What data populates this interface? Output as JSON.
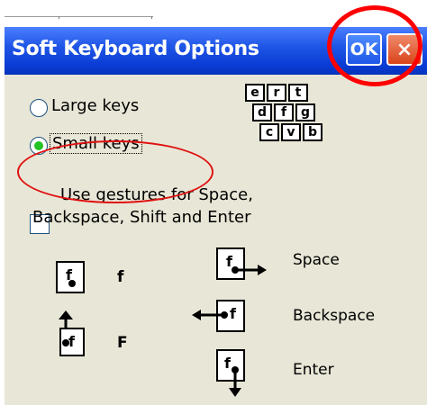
{
  "window": {
    "title": "Soft Keyboard Options",
    "ok_label": "OK",
    "close_label": "×"
  },
  "options": {
    "large_keys_label": "Large keys",
    "small_keys_label": "Small keys",
    "selected": "Small keys",
    "gestures_label_line1": "Use gestures for Space,",
    "gestures_label_line2": "Backspace, Shift and Enter",
    "gestures_checked": false
  },
  "preview_keys": {
    "row1": [
      "e",
      "r",
      "t"
    ],
    "row2": [
      "d",
      "f",
      "g"
    ],
    "row3": [
      "c",
      "v",
      "b"
    ]
  },
  "gesture_legend": {
    "icon_letter": "f",
    "tap_result": "f",
    "shift_result": "F",
    "space_label": "Space",
    "backspace_label": "Backspace",
    "enter_label": "Enter"
  },
  "colors": {
    "title_bar": "#0a3cd6",
    "window_bg": "#e8e6d6",
    "radio_selected": "#22c322",
    "annotation_red": "#ff0000"
  }
}
